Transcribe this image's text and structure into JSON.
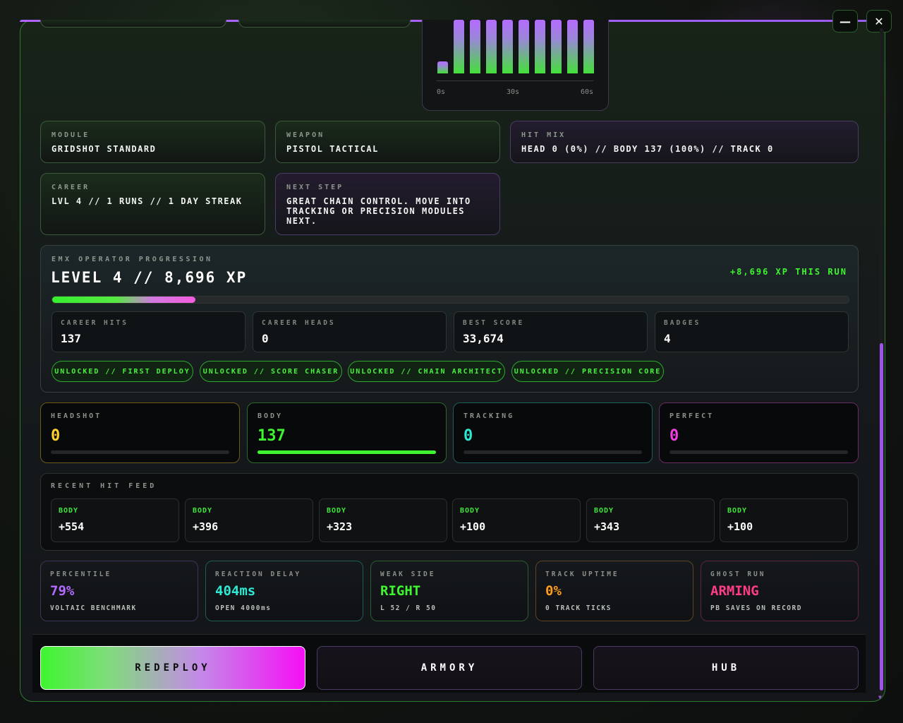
{
  "window": {
    "minimize_label": "—",
    "close_label": "✕"
  },
  "timeline": {
    "ticks": [
      "0s",
      "30s",
      "60s"
    ],
    "bars": [
      0.22,
      1.0,
      1.0,
      1.0,
      1.0,
      1.0,
      1.0,
      1.0,
      1.0,
      1.0
    ]
  },
  "info": {
    "module": {
      "label": "MODULE",
      "value": "GRIDSHOT STANDARD"
    },
    "weapon": {
      "label": "WEAPON",
      "value": "PISTOL TACTICAL"
    },
    "hit_mix": {
      "label": "HIT MIX",
      "value": "HEAD 0 (0%) // BODY 137 (100%) // TRACK 0"
    },
    "career": {
      "label": "CAREER",
      "value": "LVL 4 // 1 RUNS // 1 DAY STREAK"
    },
    "next_step": {
      "label": "NEXT STEP",
      "value": "GREAT CHAIN CONTROL. MOVE INTO TRACKING OR PRECISION MODULES NEXT."
    }
  },
  "progression": {
    "label": "EMX OPERATOR PROGRESSION",
    "title": "LEVEL 4 // 8,696 XP",
    "run_xp": "+8,696 XP THIS RUN",
    "level_progress": 0.18,
    "stats": [
      {
        "label": "CAREER HITS",
        "value": "137"
      },
      {
        "label": "CAREER HEADS",
        "value": "0"
      },
      {
        "label": "BEST SCORE",
        "value": "33,674"
      },
      {
        "label": "BADGES",
        "value": "4"
      }
    ],
    "badges": [
      "UNLOCKED // FIRST DEPLOY",
      "UNLOCKED // SCORE CHASER",
      "UNLOCKED // CHAIN ARCHITECT",
      "UNLOCKED // PRECISION CORE"
    ]
  },
  "hits": [
    {
      "label": "HEADSHOT",
      "value": "0",
      "fill": 0,
      "color": "#ffd12e",
      "border": "#6b5a1a"
    },
    {
      "label": "BODY",
      "value": "137",
      "fill": 1.0,
      "color": "#3ef52f",
      "border": "#2c6a2c"
    },
    {
      "label": "TRACKING",
      "value": "0",
      "fill": 0,
      "color": "#2ee8d2",
      "border": "#1f5e58"
    },
    {
      "label": "PERFECT",
      "value": "0",
      "fill": 0,
      "color": "#f03ee0",
      "border": "#6a2a62"
    }
  ],
  "feed": {
    "label": "RECENT HIT FEED",
    "items": [
      {
        "type": "BODY",
        "points": "+554"
      },
      {
        "type": "BODY",
        "points": "+396"
      },
      {
        "type": "BODY",
        "points": "+323"
      },
      {
        "type": "BODY",
        "points": "+100"
      },
      {
        "type": "BODY",
        "points": "+343"
      },
      {
        "type": "BODY",
        "points": "+100"
      }
    ]
  },
  "metrics": [
    {
      "label": "PERCENTILE",
      "value": "79%",
      "sub": "VOLTAIC BENCHMARK",
      "color": "#b46bff",
      "border": "#3c3556"
    },
    {
      "label": "REACTION DELAY",
      "value": "404ms",
      "sub": "OPEN 4000ms",
      "color": "#2ee8d2",
      "border": "#1f5e4f"
    },
    {
      "label": "WEAK SIDE",
      "value": "RIGHT",
      "sub": "L 52 / R 50",
      "color": "#3ef52f",
      "border": "#2b5e2b"
    },
    {
      "label": "TRACK UPTIME",
      "value": "0%",
      "sub": "0 TRACK TICKS",
      "color": "#ff9c1a",
      "border": "#5e4420"
    },
    {
      "label": "GHOST RUN",
      "value": "ARMING",
      "sub": "PB SAVES ON RECORD",
      "color": "#ff3d86",
      "border": "#5e2440"
    }
  ],
  "actions": {
    "redeploy": "REDEPLOY",
    "armory": "ARMORY",
    "hub": "HUB"
  }
}
